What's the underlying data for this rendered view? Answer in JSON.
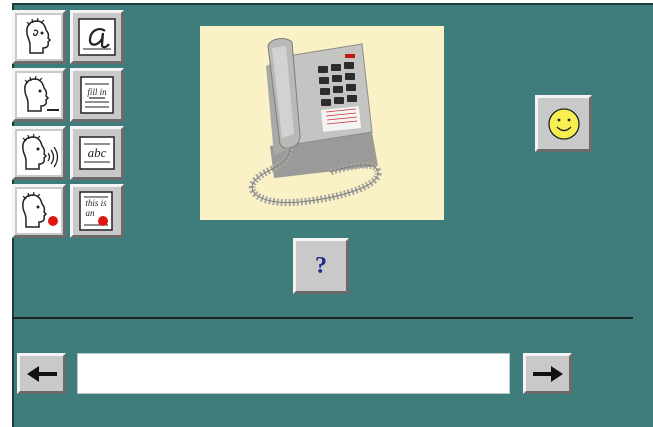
{
  "toolbar": {
    "buttons": [
      {
        "name": "listen-word-button",
        "icon": "head-speaking-icon"
      },
      {
        "name": "show-letter-button",
        "icon": "cursive-letter-card-icon",
        "text": "a"
      },
      {
        "name": "listen-blank-button",
        "icon": "head-speaking-blank-icon"
      },
      {
        "name": "fill-in-button",
        "icon": "fill-in-card-icon",
        "text": "fill in"
      },
      {
        "name": "listen-sound-button",
        "icon": "head-sound-waves-icon"
      },
      {
        "name": "spell-button",
        "icon": "abc-card-icon",
        "text": "abc"
      },
      {
        "name": "record-voice-button",
        "icon": "head-record-icon"
      },
      {
        "name": "sentence-record-button",
        "icon": "sentence-card-record-icon",
        "text": "this is an"
      }
    ]
  },
  "picture": {
    "subject": "telephone-image"
  },
  "help_button": {
    "label": "?"
  },
  "feedback": {
    "icon": "smiley-face-icon"
  },
  "answer": {
    "value": ""
  },
  "nav": {
    "prev_icon": "left-arrow-icon",
    "next_icon": "right-arrow-icon"
  },
  "colors": {
    "background": "#3f7d7c",
    "button": "#c9c9c9",
    "photo_bg": "#fbf1c6",
    "smiley": "#f6ef4f"
  }
}
